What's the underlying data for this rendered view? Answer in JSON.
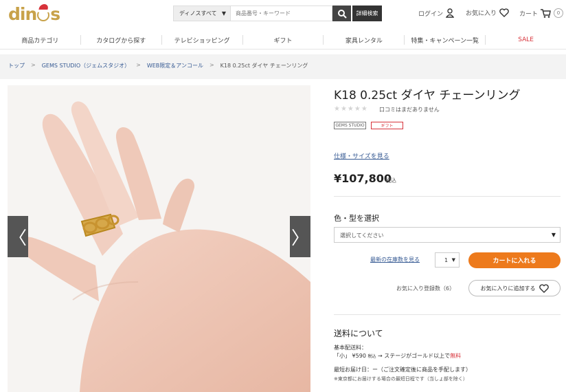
{
  "header": {
    "logo_text_left": "din",
    "logo_text_right": "s",
    "search_category": "ディノスすべて",
    "search_placeholder": "商品番号・キーワード",
    "detail_search": "詳細検索",
    "login": "ログイン",
    "favorites": "お気に入り",
    "cart": "カート",
    "cart_count": "0"
  },
  "nav": {
    "items": [
      "商品カテゴリ",
      "カタログから探す",
      "テレビショッピング",
      "ギフト",
      "家具レンタル",
      "特集・キャンペーン一覧",
      "SALE"
    ]
  },
  "breadcrumb": {
    "items": [
      "トップ",
      "GEMS STUDIO（ジェムスタジオ）",
      "WEB限定＆アンコール",
      "K18 0.25ct ダイヤ チェーンリング"
    ],
    "separator": ">"
  },
  "product": {
    "title": "K18 0.25ct ダイヤ チェーンリング",
    "stars": "★★★★★",
    "review_text": "口コミはまだありません",
    "badge_brand": "GEMS STUDIO",
    "badge_gift": "ギフト",
    "spec_link": "仕様・サイズを見る",
    "price": "¥107,800",
    "tax_label": "税込",
    "select_label": "色・型を選択",
    "select_placeholder": "選択してください",
    "stock_link": "最新の在庫数を見る",
    "quantity": "1",
    "cart_button": "カートに入れる",
    "favorite_count": "お気に入り登録数（6）",
    "favorite_button": "お気に入りに追加する"
  },
  "shipping": {
    "title": "送料について",
    "base_label": "基本配送料：",
    "size_small": "「小」",
    "fee": "¥590",
    "fee_tax": "税込",
    "fee_note": "→ ステージがゴールド以上で",
    "free": "無料",
    "earliest_delivery": "最短お届け日：ー（ご注文確定後に商品を手配します）",
    "note": "※東京都にお届けする場合の最短日程です（当しょ部を除く）"
  },
  "gallery": {
    "prev_arrow": "〈",
    "next_arrow": "〉"
  }
}
